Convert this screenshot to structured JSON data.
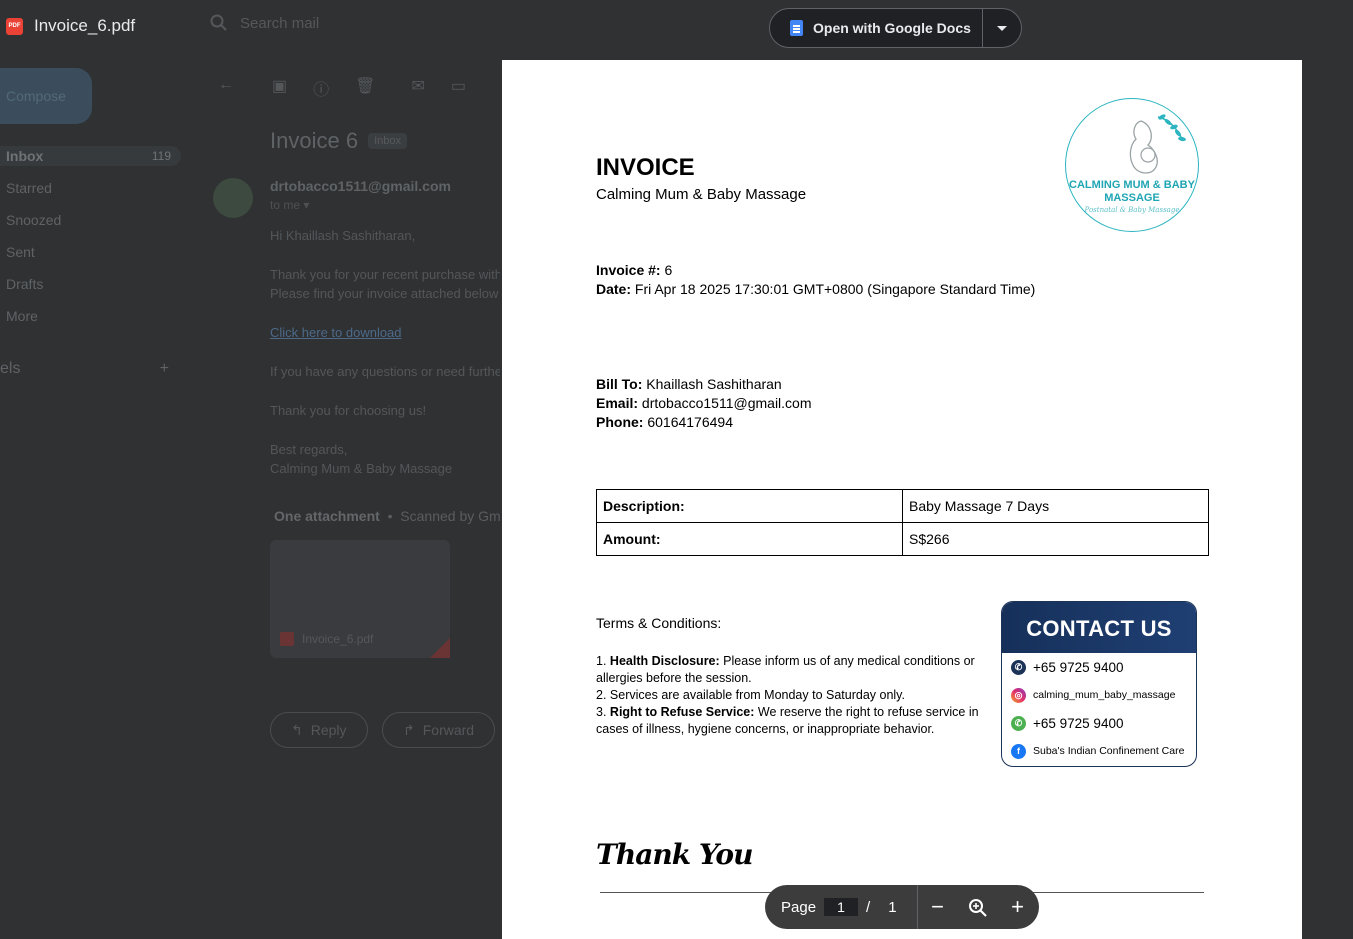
{
  "viewer": {
    "file_name": "Invoice_6.pdf",
    "pdf_badge": "PDF",
    "open_with_label": "Open with Google Docs"
  },
  "gmail": {
    "search_placeholder": "Search mail",
    "compose_label": "Compose",
    "nav": [
      {
        "label": "Inbox",
        "count": "119"
      },
      {
        "label": "Starred",
        "count": ""
      },
      {
        "label": "Snoozed",
        "count": ""
      },
      {
        "label": "Sent",
        "count": ""
      },
      {
        "label": "Drafts",
        "count": ""
      },
      {
        "label": "More",
        "count": ""
      }
    ],
    "labels_heading": "els",
    "subject": "Invoice 6",
    "subject_tag": "Inbox",
    "sender": "drtobacco1511@gmail.com",
    "to_me": "to me",
    "body": {
      "greeting": "Hi Khaillash Sashitharan,",
      "line1": "Thank you for your recent purchase with",
      "line2": "Please find your invoice attached below",
      "link": "Click here to download",
      "line3": "If you have any questions or need furthe",
      "line4": "Thank you for choosing us!",
      "signoff1": "Best regards,",
      "signoff2": "Calming Mum & Baby Massage"
    },
    "attachment_heading": "One attachment",
    "attachment_scan": "Scanned by Gm",
    "attachment_name": "Invoice_6.pdf",
    "reply_label": "Reply",
    "forward_label": "Forward"
  },
  "invoice": {
    "title": "INVOICE",
    "business": "Calming Mum & Baby Massage",
    "logo_text": "CALMING MUM & BABY MASSAGE",
    "logo_tagline": "Postnatal & Baby Massage",
    "number_label": "Invoice #:",
    "number": "6",
    "date_label": "Date:",
    "date": "Fri Apr 18 2025 17:30:01 GMT+0800 (Singapore Standard Time)",
    "bill_to_label": "Bill To:",
    "bill_to": "Khaillash Sashitharan",
    "email_label": "Email:",
    "email": "drtobacco1511@gmail.com",
    "phone_label": "Phone:",
    "phone": "60164176494",
    "description_label": "Description:",
    "description": "Baby Massage 7 Days",
    "amount_label": "Amount:",
    "amount": "S$266",
    "terms_heading": "Terms & Conditions:",
    "terms": [
      {
        "num": "1.",
        "bold": "Health Disclosure:",
        "text": "Please inform us of any medical conditions or allergies before the session."
      },
      {
        "num": "2.",
        "bold": "",
        "text": "Services are available from Monday to Saturday only."
      },
      {
        "num": "3.",
        "bold": "Right to Refuse Service:",
        "text": "We reserve the right to refuse service in cases of illness, hygiene concerns, or inappropriate behavior."
      }
    ],
    "contact_heading": "CONTACT US",
    "contact": {
      "phone1": "+65 9725 9400",
      "instagram": "calming_mum_baby_massage",
      "whatsapp": "+65 9725 9400",
      "facebook": "Suba's Indian Confinement Care"
    },
    "thank_you": "Thank You"
  },
  "pager": {
    "page_label": "Page",
    "current": "1",
    "separator": "/",
    "total": "1"
  },
  "colors": {
    "contact_header": "#16305a",
    "logo_teal": "#1fa5b3",
    "pdf_red": "#ea4335",
    "docs_blue": "#4285f4"
  }
}
